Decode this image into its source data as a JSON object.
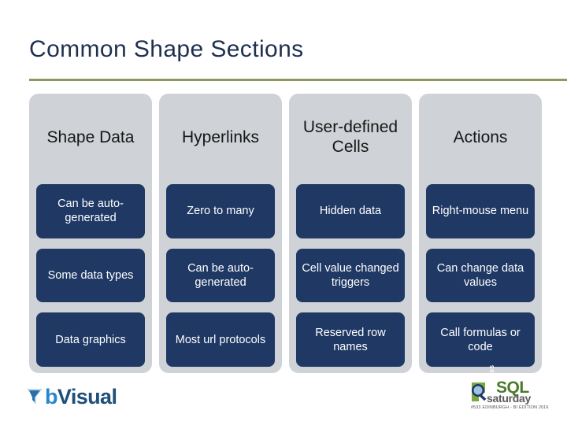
{
  "slide": {
    "title": "Common Shape Sections",
    "rule_color": "#8a9a5b",
    "title_color": "#1f3050"
  },
  "table": {
    "header_bg": "#cfd2d6",
    "cell_bg": "#1f3864",
    "cell_text_color": "#ffffff",
    "headers": [
      "Shape Data",
      "Hyperlinks",
      "User-defined Cells",
      "Actions"
    ],
    "rows": [
      [
        "Can be auto-generated",
        "Zero to many",
        "Hidden data",
        "Right-mouse menu"
      ],
      [
        "Some data types",
        "Can be auto-generated",
        "Cell value changed triggers",
        "Can change data values"
      ],
      [
        "Data graphics",
        "Most url protocols",
        "Reserved row names",
        "Call formulas or code"
      ]
    ]
  },
  "footer": {
    "bvisual": {
      "mark_icon": "funnel-arrow-icon",
      "word_b": "b",
      "word_visual": "Visual",
      "accent_color": "#2a87c8"
    },
    "sqlsaturday": {
      "mark_icon": "magnifier-icon",
      "pass": "PASS",
      "sql": "SQL",
      "saturday": "saturday",
      "subtitle": "#533 EDINBURGH - BI EDITION 2016",
      "green": "#4a7a2a"
    }
  }
}
